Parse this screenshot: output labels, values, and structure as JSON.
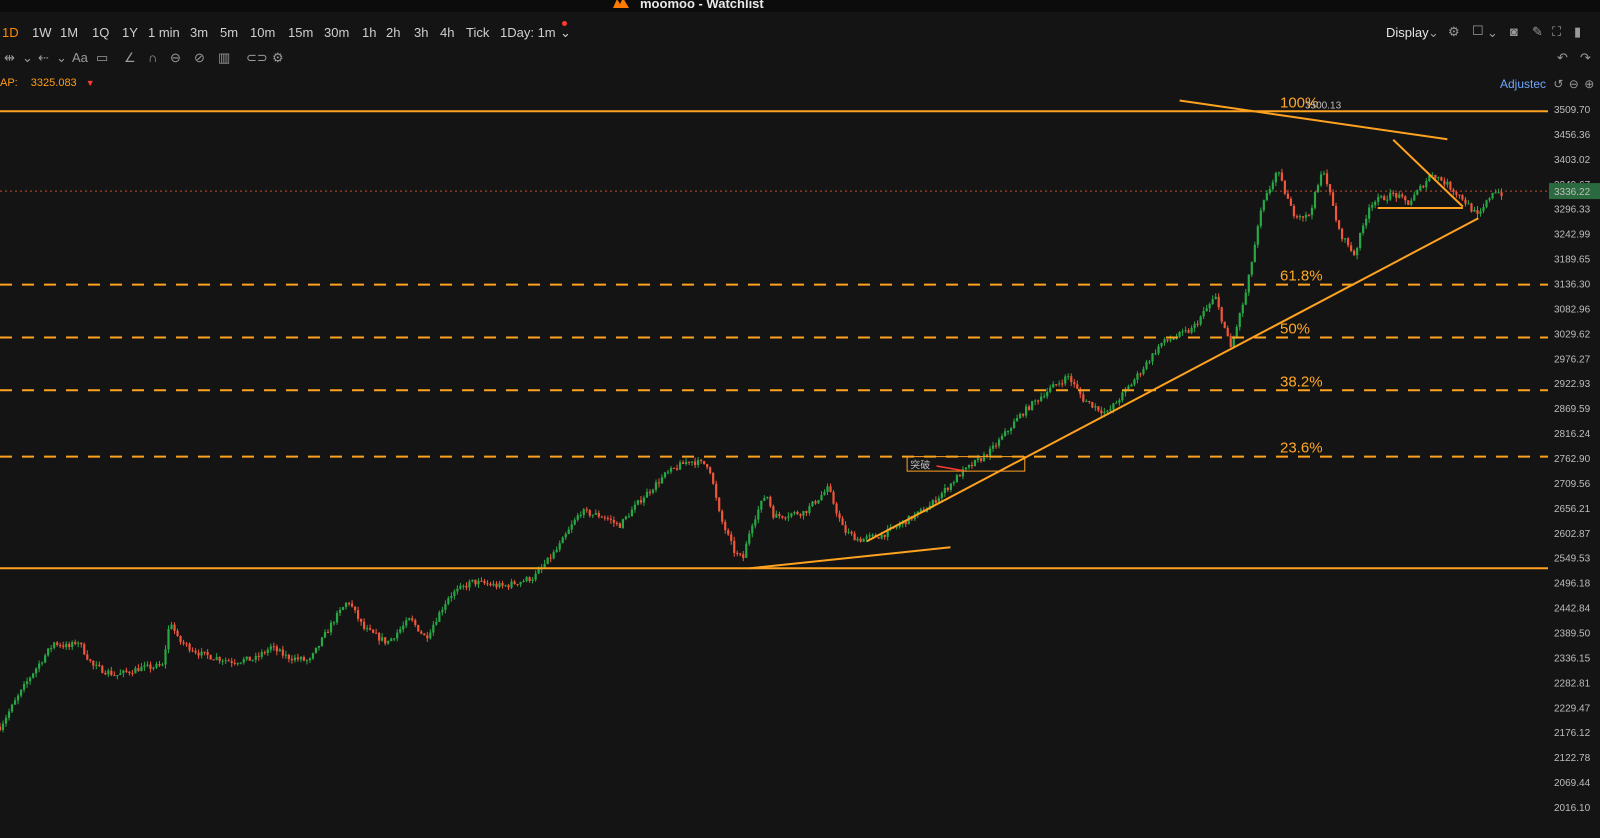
{
  "window": {
    "title": "moomoo - Watchlist"
  },
  "timeframes": [
    {
      "label": "1D",
      "active": true
    },
    {
      "label": "1W"
    },
    {
      "label": "1M"
    },
    {
      "label": "1Q"
    },
    {
      "label": "1Y"
    },
    {
      "label": "1 min"
    },
    {
      "label": "3m"
    },
    {
      "label": "5m"
    },
    {
      "label": "10m"
    },
    {
      "label": "15m"
    },
    {
      "label": "30m"
    },
    {
      "label": "1h"
    },
    {
      "label": "2h"
    },
    {
      "label": "3h"
    },
    {
      "label": "4h"
    },
    {
      "label": "Tick"
    },
    {
      "label": "1Day: 1m"
    }
  ],
  "toolbar": {
    "display_label": "Display"
  },
  "indicator": {
    "label": "AP:",
    "value": "3325.083"
  },
  "adjusted_label": "Adjustec",
  "colors": {
    "up": "#27a845",
    "down": "#f0563a",
    "accent": "#ffa21f",
    "background": "#141414"
  },
  "chart_data": {
    "type": "candlestick",
    "y_axis": {
      "min": 2016.1,
      "max": 3509.7,
      "ticks": [
        "3509.70",
        "3456.36",
        "3403.02",
        "3349.67",
        "3296.33",
        "3242.99",
        "3189.65",
        "3136.30",
        "3082.96",
        "3029.62",
        "2976.27",
        "2922.93",
        "2869.59",
        "2816.24",
        "2762.90",
        "2709.56",
        "2656.21",
        "2602.87",
        "2549.53",
        "2496.18",
        "2442.84",
        "2389.50",
        "2336.15",
        "2282.81",
        "2229.47",
        "2176.12",
        "2122.78",
        "2069.44",
        "2016.10"
      ]
    },
    "current_price": "3336.22",
    "high_label": "3500.13",
    "support_lines": [
      3507,
      2529
    ],
    "fib_levels": [
      {
        "label": "100%",
        "value": 3507
      },
      {
        "label": "61.8%",
        "value": 3136
      },
      {
        "label": "50%",
        "value": 3023
      },
      {
        "label": "38.2%",
        "value": 2910
      },
      {
        "label": "23.6%",
        "value": 2768
      }
    ],
    "annotation": {
      "text": "突破"
    },
    "trendlines": [
      {
        "from": [
          0.484,
          2529
        ],
        "to": [
          0.614,
          2574
        ]
      },
      {
        "from": [
          0.56,
          2587
        ],
        "to": [
          0.955,
          3278
        ]
      },
      {
        "from": [
          0.762,
          3530
        ],
        "to": [
          0.935,
          3447
        ]
      },
      {
        "from": [
          0.9,
          3446
        ],
        "to": [
          0.945,
          3303
        ]
      }
    ],
    "anchors": [
      [
        0,
        2190
      ],
      [
        0.02,
        2300
      ],
      [
        0.035,
        2370
      ],
      [
        0.045,
        2360
      ],
      [
        0.05,
        2375
      ],
      [
        0.06,
        2320
      ],
      [
        0.075,
        2300
      ],
      [
        0.09,
        2315
      ],
      [
        0.105,
        2320
      ],
      [
        0.11,
        2420
      ],
      [
        0.115,
        2375
      ],
      [
        0.13,
        2345
      ],
      [
        0.15,
        2330
      ],
      [
        0.165,
        2335
      ],
      [
        0.175,
        2360
      ],
      [
        0.185,
        2340
      ],
      [
        0.2,
        2330
      ],
      [
        0.215,
        2415
      ],
      [
        0.225,
        2460
      ],
      [
        0.235,
        2400
      ],
      [
        0.25,
        2370
      ],
      [
        0.265,
        2420
      ],
      [
        0.275,
        2380
      ],
      [
        0.29,
        2470
      ],
      [
        0.305,
        2500
      ],
      [
        0.325,
        2490
      ],
      [
        0.345,
        2510
      ],
      [
        0.36,
        2570
      ],
      [
        0.375,
        2650
      ],
      [
        0.39,
        2640
      ],
      [
        0.4,
        2620
      ],
      [
        0.415,
        2680
      ],
      [
        0.43,
        2730
      ],
      [
        0.445,
        2760
      ],
      [
        0.458,
        2750
      ],
      [
        0.465,
        2640
      ],
      [
        0.475,
        2560
      ],
      [
        0.48,
        2550
      ],
      [
        0.485,
        2620
      ],
      [
        0.495,
        2690
      ],
      [
        0.5,
        2640
      ],
      [
        0.52,
        2650
      ],
      [
        0.535,
        2700
      ],
      [
        0.545,
        2610
      ],
      [
        0.555,
        2590
      ],
      [
        0.57,
        2600
      ],
      [
        0.585,
        2630
      ],
      [
        0.6,
        2660
      ],
      [
        0.62,
        2730
      ],
      [
        0.64,
        2780
      ],
      [
        0.66,
        2860
      ],
      [
        0.675,
        2905
      ],
      [
        0.69,
        2940
      ],
      [
        0.7,
        2890
      ],
      [
        0.715,
        2860
      ],
      [
        0.73,
        2920
      ],
      [
        0.75,
        3010
      ],
      [
        0.77,
        3040
      ],
      [
        0.785,
        3110
      ],
      [
        0.795,
        3000
      ],
      [
        0.805,
        3120
      ],
      [
        0.815,
        3300
      ],
      [
        0.825,
        3380
      ],
      [
        0.835,
        3290
      ],
      [
        0.845,
        3280
      ],
      [
        0.855,
        3385
      ],
      [
        0.865,
        3250
      ],
      [
        0.875,
        3200
      ],
      [
        0.885,
        3310
      ],
      [
        0.9,
        3330
      ],
      [
        0.91,
        3310
      ],
      [
        0.925,
        3375
      ],
      [
        0.935,
        3350
      ],
      [
        0.945,
        3320
      ],
      [
        0.955,
        3280
      ],
      [
        0.965,
        3340
      ],
      [
        0.97,
        3330
      ]
    ]
  }
}
